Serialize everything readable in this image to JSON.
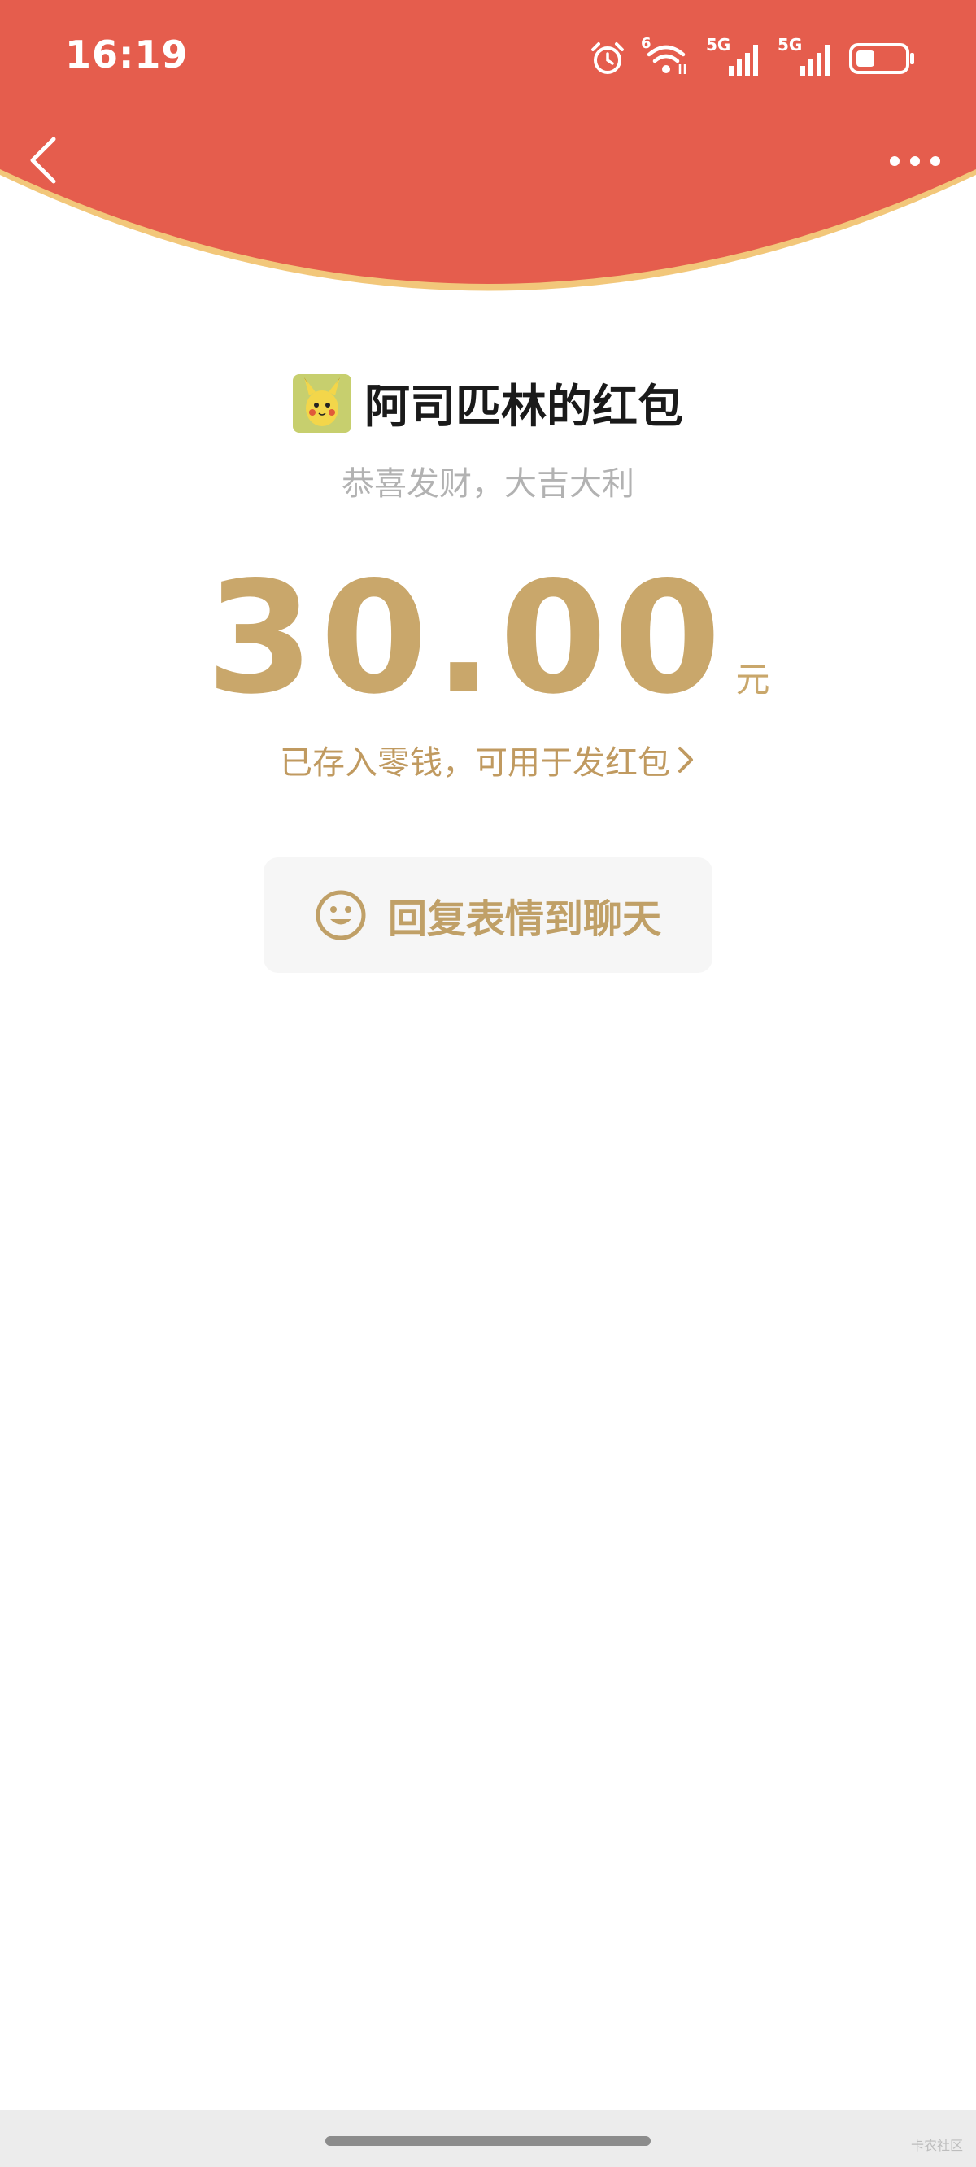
{
  "status_bar": {
    "time": "16:19",
    "wifi_badge": "6",
    "sim1_label": "5G",
    "sim2_label": "5G",
    "icons": [
      "alarm-icon",
      "wifi-icon",
      "signal-icon",
      "signal-icon",
      "battery-icon"
    ]
  },
  "nav": {
    "back_icon": "chevron-left-icon",
    "more_icon": "more-horizontal-icon"
  },
  "red_packet": {
    "sender_name": "阿司匹林的红包",
    "greeting": "恭喜发财，大吉大利",
    "amount": "30.00",
    "currency": "元",
    "wallet_note": "已存入零钱，可用于发红包",
    "reply_button_label": "回复表情到聊天"
  },
  "footer": {
    "watermark": "卡农社区"
  },
  "colors": {
    "header_red": "#E55D4D",
    "header_border": "#F2C77A",
    "gold": "#C9A76B",
    "name_text": "#1A1A1A",
    "muted_text": "#B2B2B2"
  }
}
